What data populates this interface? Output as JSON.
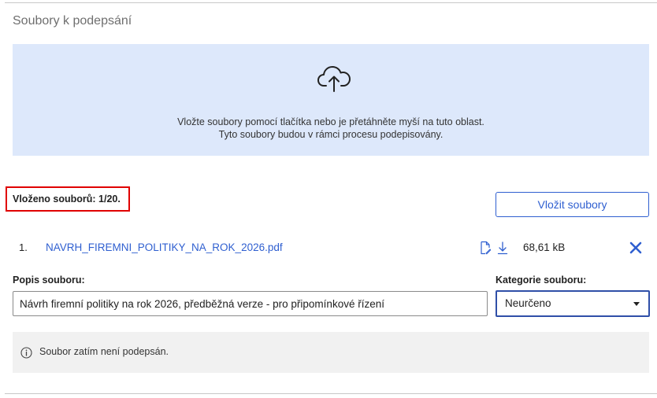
{
  "section": {
    "title": "Soubory k podepsání"
  },
  "dropzone": {
    "icon": "cloud-upload-icon",
    "line1": "Vložte soubory pomocí tlačítka nebo je přetáhněte myší na tuto oblast.",
    "line2": "Tyto soubory budou v rámci procesu podepisovány."
  },
  "counter": {
    "text": "Vloženo souborů: 1/20."
  },
  "insert_button": {
    "label": "Vložit soubory"
  },
  "files": [
    {
      "index": "1.",
      "name": "NAVRH_FIREMNI_POLITIKY_NA_ROK_2026.pdf",
      "size": "68,61 kB",
      "icons": [
        "file-sign-icon",
        "download-icon",
        "close-icon"
      ],
      "description_label": "Popis souboru:",
      "description_value": "Návrh firemní politiky na rok 2026, předběžná verze - pro připomínkové řízení",
      "category_label": "Kategorie souboru:",
      "category_value": "Neurčeno",
      "status_icon": "info-icon",
      "status_text": "Soubor zatím není podepsán."
    }
  ],
  "colors": {
    "accent": "#2f5fd0",
    "dropzone_bg": "#dde8fb",
    "highlight_border": "#e00000",
    "status_bg": "#f1f1f1"
  }
}
